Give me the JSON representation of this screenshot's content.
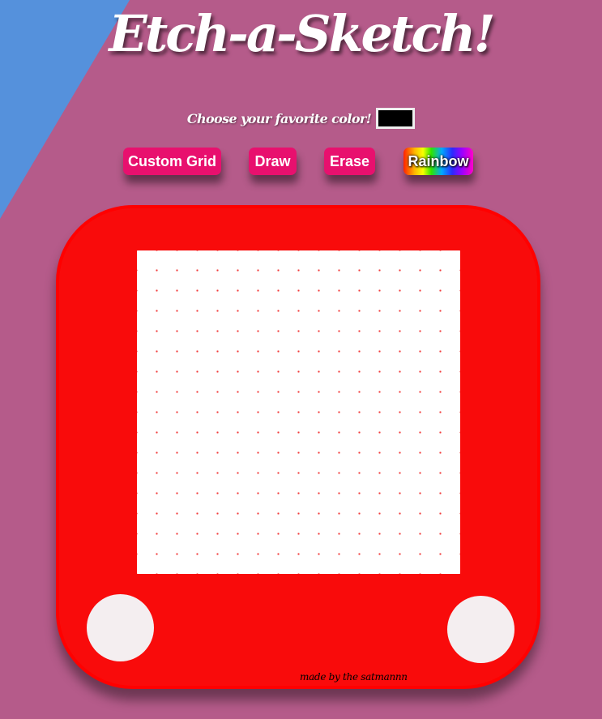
{
  "header": {
    "title": "Etch-a-Sketch!"
  },
  "color_picker": {
    "label": "Choose your favorite color!",
    "value": "#000000"
  },
  "buttons": {
    "custom_grid": "Custom Grid",
    "draw": "Draw",
    "erase": "Erase",
    "rainbow": "Rainbow"
  },
  "grid": {
    "rows": 16,
    "columns": 16,
    "cell_color": "#ffffff",
    "dot_color": "#f23a3a"
  },
  "footer": {
    "signature": "made by the satmannn"
  },
  "colors": {
    "background": "#b55b8a",
    "corner_accent": "#5591dc",
    "frame": "#f90b0b",
    "button": "#e8106e",
    "knob": "#f4eef0"
  }
}
